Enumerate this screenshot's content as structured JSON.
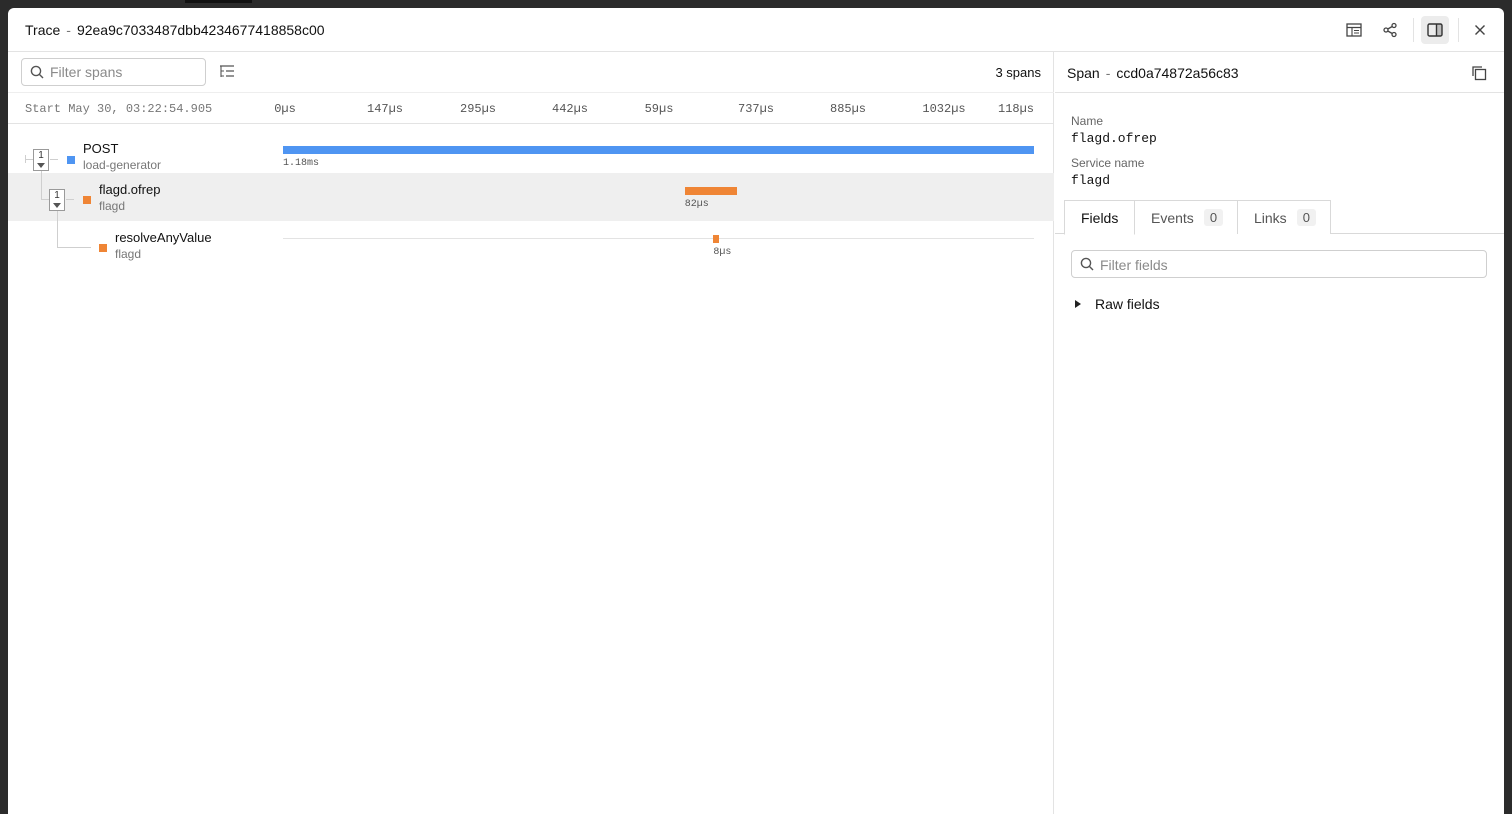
{
  "header": {
    "title_label": "Trace",
    "separator": "-",
    "trace_id": "92ea9c7033487dbb4234677418858c00"
  },
  "toolbar": {
    "filter_placeholder": "Filter spans",
    "span_count": "3 spans"
  },
  "timeline": {
    "start_label": "Start May 30, 03:22:54.905",
    "ticks": [
      "0µs",
      "147µs",
      "295µs",
      "442µs",
      "59µs",
      "737µs",
      "885µs",
      "1032µs",
      "118µs"
    ]
  },
  "spans": [
    {
      "name": "POST",
      "service": "load-generator",
      "duration": "1.18ms",
      "child_count": "1",
      "color": "#4f95f2",
      "start_fraction": 0.0,
      "width_fraction": 1.0
    },
    {
      "name": "flagd.ofrep",
      "service": "flagd",
      "duration": "82µs",
      "child_count": "1",
      "color": "#ef8535",
      "start_fraction": 0.535,
      "width_fraction": 0.069
    },
    {
      "name": "resolveAnyValue",
      "service": "flagd",
      "duration": "8µs",
      "color": "#ef8535",
      "start_fraction": 0.573,
      "width_fraction": 0.007
    }
  ],
  "detail": {
    "title_label": "Span",
    "separator": "-",
    "span_id": "ccd0a74872a56c83",
    "name_label": "Name",
    "name_value": "flagd.ofrep",
    "service_label": "Service name",
    "service_value": "flagd",
    "tabs": [
      {
        "label": "Fields"
      },
      {
        "label": "Events",
        "count": "0"
      },
      {
        "label": "Links",
        "count": "0"
      }
    ],
    "filter_placeholder": "Filter fields",
    "raw_fields_label": "Raw fields"
  },
  "icons": {
    "table": "table-icon",
    "share": "share-icon",
    "panel": "side-panel-icon",
    "close": "close-icon",
    "copy": "copy-icon",
    "search": "search-icon",
    "tree": "tree-list-icon"
  }
}
